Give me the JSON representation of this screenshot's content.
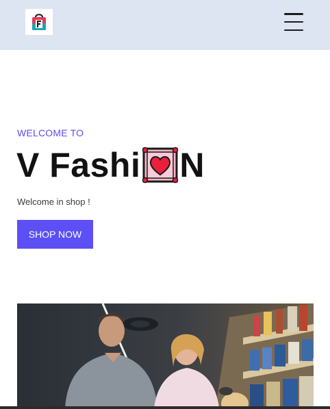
{
  "header": {
    "logo_icon": "shopping-bag-f-logo-icon",
    "menu_icon": "hamburger-menu-icon",
    "background": "#dde5f3"
  },
  "hero": {
    "eyebrow": "WELCOME TO",
    "title_prefix": "V Fashi",
    "title_emoji": "framed-heart-icon",
    "title_suffix": "N",
    "subtitle": "Welcome in shop !",
    "cta_label": "SHOP NOW",
    "accent": "#5b4ff5"
  },
  "image": {
    "subject": "shopping-couple-photo"
  }
}
